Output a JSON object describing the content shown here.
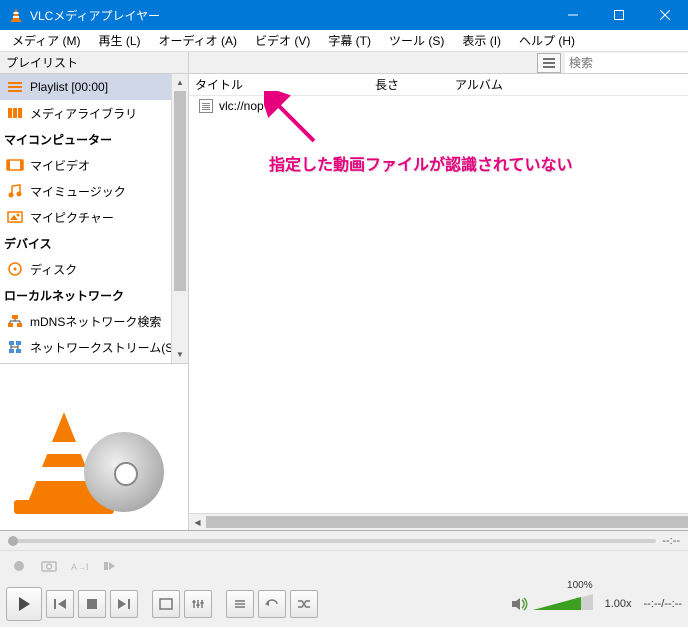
{
  "titlebar": {
    "title": "VLCメディアプレイヤー"
  },
  "menubar": [
    "メディア (M)",
    "再生 (L)",
    "オーディオ (A)",
    "ビデオ (V)",
    "字幕 (T)",
    "ツール (S)",
    "表示 (I)",
    "ヘルプ (H)"
  ],
  "sidebar": {
    "header": "プレイリスト",
    "items": [
      {
        "icon": "playlist",
        "label": "Playlist [00:00]",
        "selected": true
      },
      {
        "icon": "library",
        "label": "メディアライブラリ"
      },
      {
        "header": true,
        "label": "マイコンピューター"
      },
      {
        "icon": "video",
        "label": "マイビデオ"
      },
      {
        "icon": "music",
        "label": "マイミュージック"
      },
      {
        "icon": "picture",
        "label": "マイピクチャー"
      },
      {
        "header": true,
        "label": "デバイス"
      },
      {
        "icon": "disc",
        "label": "ディスク"
      },
      {
        "header": true,
        "label": "ローカルネットワーク"
      },
      {
        "icon": "mdns",
        "label": "mDNSネットワーク検索"
      },
      {
        "icon": "sap",
        "label": "ネットワークストリーム(SAP)"
      }
    ]
  },
  "main": {
    "search_placeholder": "検索",
    "columns": {
      "title": "タイトル",
      "length": "長さ",
      "album": "アルバム"
    },
    "items": [
      {
        "title": "vlc://nop"
      }
    ],
    "annotation": "指定した動画ファイルが認識されていない"
  },
  "status": {
    "time_left": "--:--",
    "speed": "1.00x",
    "time_right": "--:--/--:--",
    "volume_label": "100%"
  }
}
